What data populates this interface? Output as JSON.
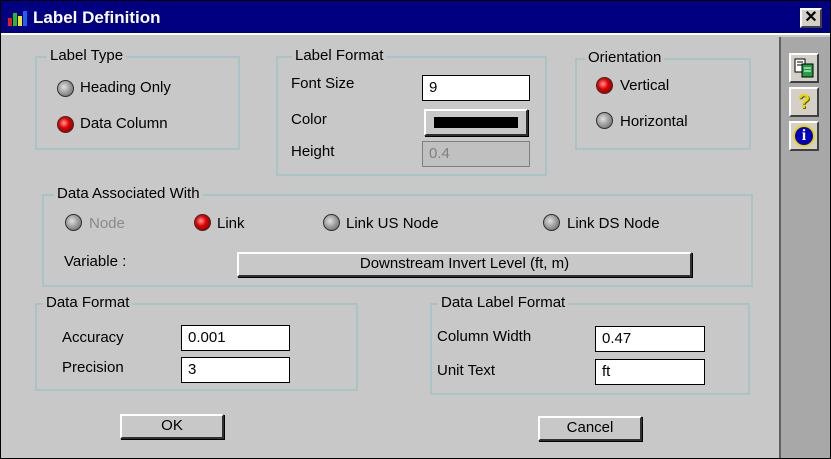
{
  "window": {
    "title": "Label Definition",
    "close_glyph": "✕"
  },
  "label_type": {
    "title": "Label Type",
    "options": [
      {
        "label": "Heading Only",
        "selected": false
      },
      {
        "label": "Data Column",
        "selected": true
      }
    ]
  },
  "label_format": {
    "title": "Label Format",
    "font_size_label": "Font Size",
    "font_size_value": "9",
    "color_label": "Color",
    "color_value": "#000000",
    "height_label": "Height",
    "height_value": "0.4"
  },
  "orientation": {
    "title": "Orientation",
    "options": [
      {
        "label": "Vertical",
        "selected": true
      },
      {
        "label": "Horizontal",
        "selected": false
      }
    ]
  },
  "data_associated": {
    "title": "Data Associated With",
    "options": [
      {
        "label": "Node",
        "selected": false,
        "enabled": false
      },
      {
        "label": "Link",
        "selected": true,
        "enabled": true
      },
      {
        "label": "Link US Node",
        "selected": false,
        "enabled": true
      },
      {
        "label": "Link DS Node",
        "selected": false,
        "enabled": true
      }
    ],
    "variable_label": "Variable :",
    "variable_value": "Downstream Invert Level (ft, m)"
  },
  "data_format": {
    "title": "Data Format",
    "accuracy_label": "Accuracy",
    "accuracy_value": "0.001",
    "precision_label": "Precision",
    "precision_value": "3"
  },
  "data_label_format": {
    "title": "Data Label Format",
    "column_width_label": "Column Width",
    "column_width_value": "0.47",
    "unit_text_label": "Unit Text",
    "unit_text_value": "ft"
  },
  "buttons": {
    "ok": "OK",
    "cancel": "Cancel"
  },
  "toolbar": [
    {
      "icon": "copy-icon"
    },
    {
      "icon": "help-icon",
      "glyph": "?"
    },
    {
      "icon": "info-icon",
      "glyph": "i"
    }
  ]
}
